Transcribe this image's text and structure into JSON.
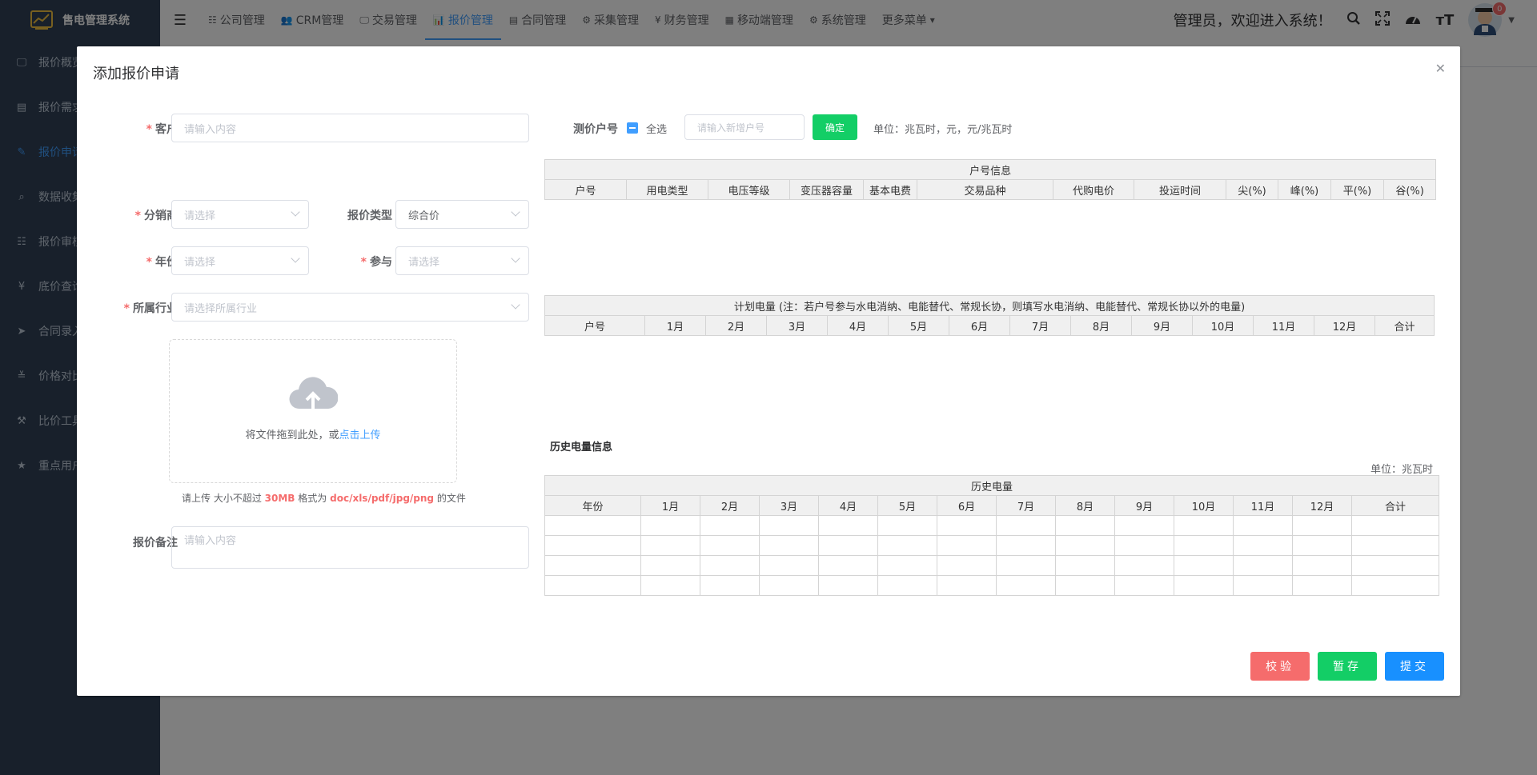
{
  "app": {
    "title": "售电管理系统"
  },
  "sidebar": {
    "items": [
      {
        "label": "报价概览",
        "icon": "monitor-icon"
      },
      {
        "label": "报价需求",
        "icon": "list-icon"
      },
      {
        "label": "报价申请",
        "icon": "edit-icon"
      },
      {
        "label": "数据收集",
        "icon": "search-icon"
      },
      {
        "label": "报价审核",
        "icon": "table-icon"
      },
      {
        "label": "底价查询",
        "icon": "yen-icon"
      },
      {
        "label": "合同录入",
        "icon": "send-icon"
      },
      {
        "label": "价格对比",
        "icon": "sliders-icon"
      },
      {
        "label": "比价工具",
        "icon": "tools-icon"
      },
      {
        "label": "重点用户",
        "icon": "star-icon"
      }
    ]
  },
  "topnav": {
    "tabs": [
      {
        "label": "公司管理",
        "icon": "☷"
      },
      {
        "label": "CRM管理",
        "icon": "👥"
      },
      {
        "label": "交易管理",
        "icon": "🖵"
      },
      {
        "label": "报价管理",
        "icon": "📊"
      },
      {
        "label": "合同管理",
        "icon": "▤"
      },
      {
        "label": "采集管理",
        "icon": "⚙"
      },
      {
        "label": "财务管理",
        "icon": "¥"
      },
      {
        "label": "移动端管理",
        "icon": "▦"
      },
      {
        "label": "系统管理",
        "icon": "⚙"
      },
      {
        "label": "更多菜单",
        "icon": "▾"
      }
    ],
    "welcome": "管理员，欢迎进入系统！",
    "badge_count": "0"
  },
  "dialog": {
    "title": "添加报价申请",
    "form": {
      "customer_label": "客户",
      "customer_placeholder": "请输入内容",
      "distributor_label": "分销商",
      "distributor_placeholder": "请选择",
      "quote_type_label": "报价类型",
      "quote_type_value": "综合价",
      "year_label": "年份",
      "year_placeholder": "请选择",
      "participate_label": "参与",
      "participate_placeholder": "请选择",
      "industry_label": "所属行业",
      "industry_placeholder": "请选择所属行业",
      "upload_text": "将文件拖到此处，或",
      "upload_link": "点击上传",
      "upload_tip_prefix": "请上传 大小不超过",
      "upload_tip_size": "30MB",
      "upload_tip_mid": "格式为",
      "upload_tip_formats": "doc/xls/pdf/jpg/png",
      "upload_tip_suffix": "的文件",
      "remark_label": "报价备注",
      "remark_placeholder": "请输入内容"
    },
    "account_bar": {
      "label": "测价户号",
      "select_all": "全选",
      "new_account_placeholder": "请输入新增户号",
      "confirm": "确定",
      "unit": "单位：兆瓦时，元，元/兆瓦时"
    },
    "account_table": {
      "caption": "户号信息",
      "headers": [
        "户号",
        "用电类型",
        "电压等级",
        "变压器容量",
        "基本电费",
        "交易品种",
        "代购电价",
        "投运时间",
        "尖(%)",
        "峰(%)",
        "平(%)",
        "谷(%)"
      ]
    },
    "plan_table": {
      "caption": "计划电量 (注：若户号参与水电消纳、电能替代、常规长协，则填写水电消纳、电能替代、常规长协以外的电量)",
      "headers": [
        "户号",
        "1月",
        "2月",
        "3月",
        "4月",
        "5月",
        "6月",
        "7月",
        "8月",
        "9月",
        "10月",
        "11月",
        "12月",
        "合计"
      ]
    },
    "history": {
      "section_title": "历史电量信息",
      "unit": "单位：兆瓦时",
      "caption": "历史电量",
      "headers": [
        "年份",
        "1月",
        "2月",
        "3月",
        "4月",
        "5月",
        "6月",
        "7月",
        "8月",
        "9月",
        "10月",
        "11月",
        "12月",
        "合计"
      ],
      "rows": 4
    },
    "buttons": {
      "verify": "校验",
      "save": "暂存",
      "submit": "提交"
    }
  }
}
